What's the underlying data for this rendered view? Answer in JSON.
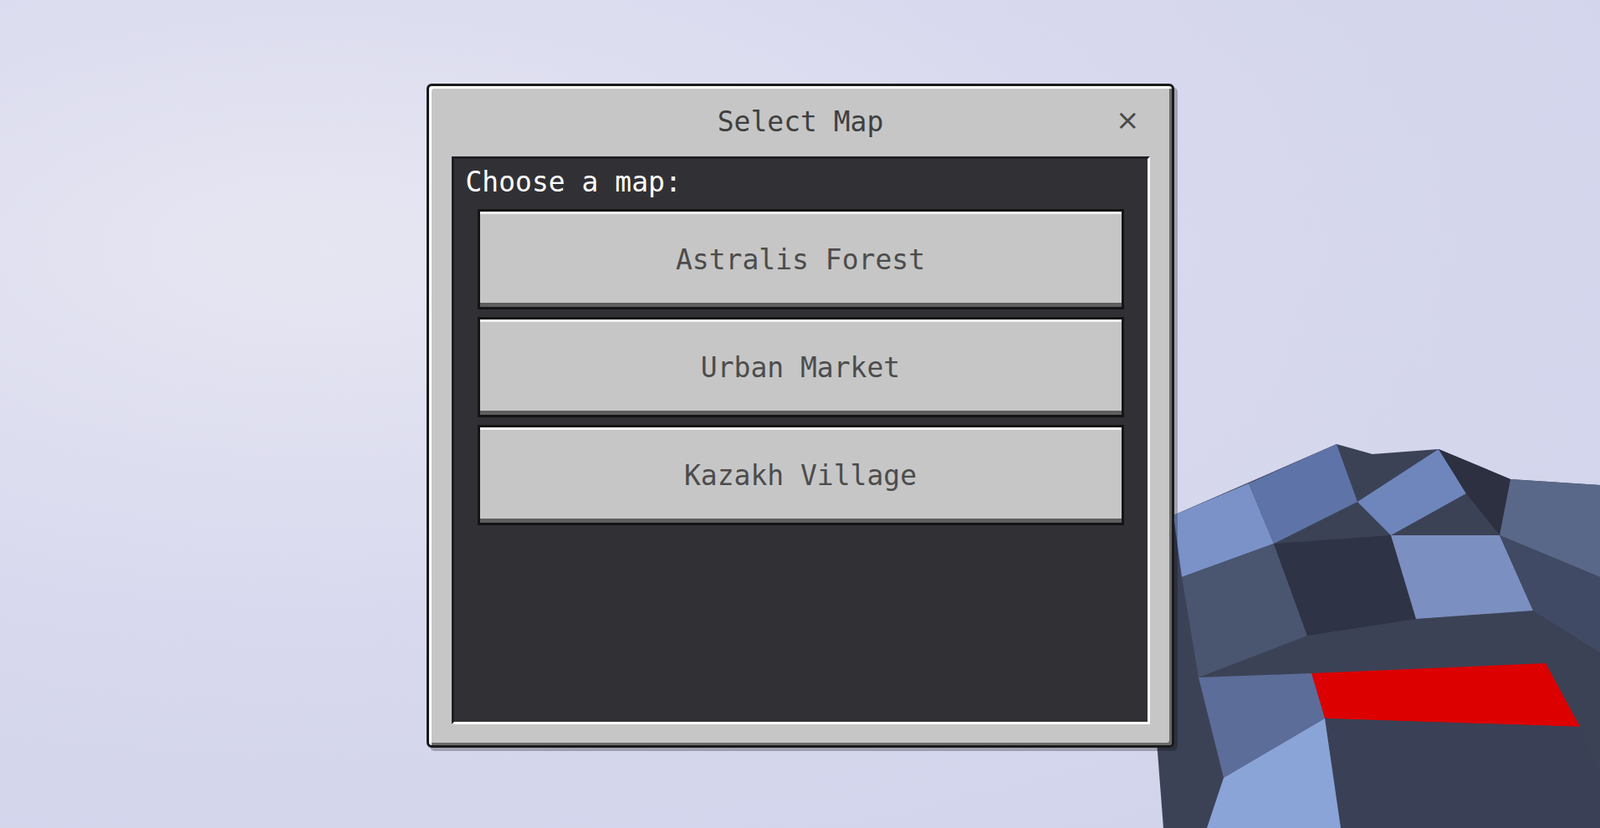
{
  "window": {
    "title": "Select Map",
    "close": "×"
  },
  "prompt": "Choose a map:",
  "maps": [
    {
      "label": "Astralis Forest"
    },
    {
      "label": "Urban Market"
    },
    {
      "label": "Kazakh Village"
    }
  ]
}
